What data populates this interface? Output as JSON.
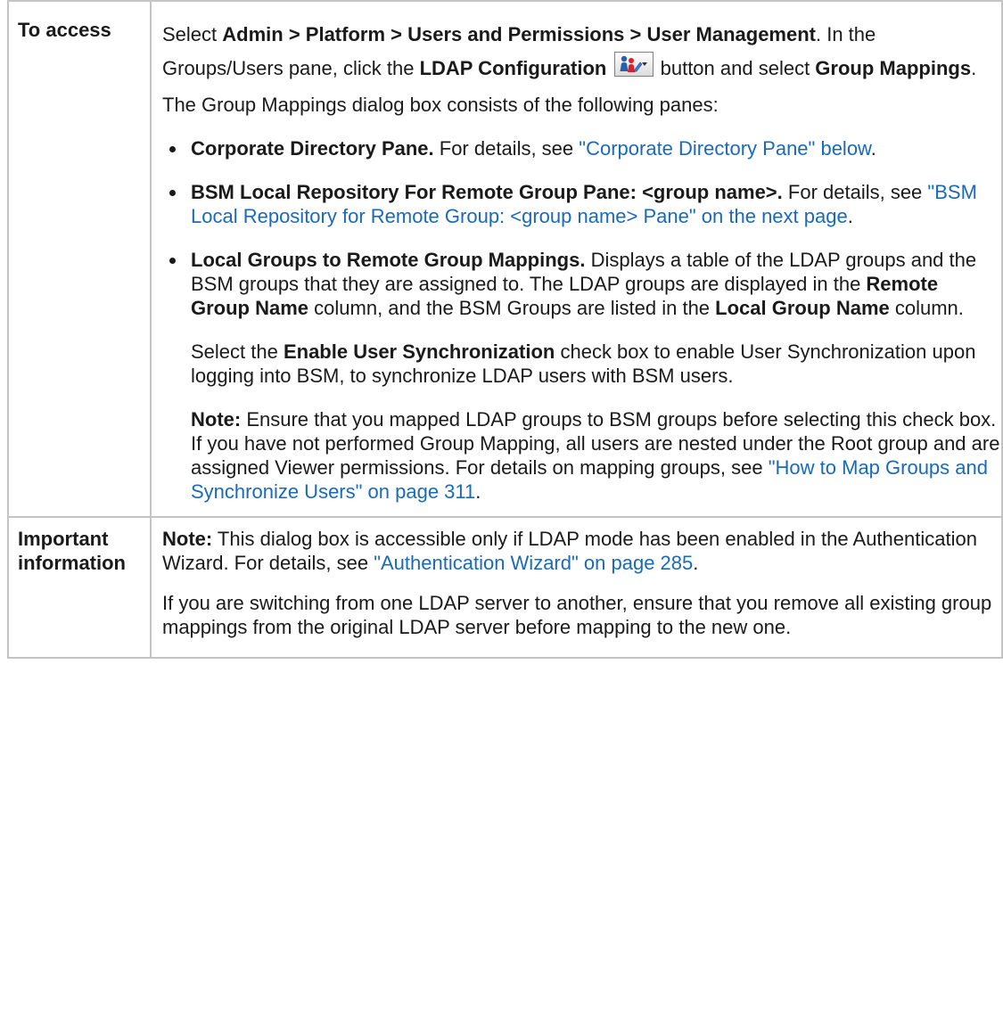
{
  "access": {
    "label": "To access",
    "intro": {
      "t1": "Select ",
      "path": "Admin > Platform > Users and Permissions > User Management",
      "t2": ". In the Groups/Users pane, click the ",
      "ldap_button": "LDAP Configuration",
      "t3": " button and select ",
      "group_mappings": "Group Mappings",
      "t4": "."
    },
    "consists": "The Group Mappings dialog box consists of the following panes:",
    "items": [
      {
        "title": "Corporate Directory Pane.",
        "text": " For details, see ",
        "link": "\"Corporate Directory Pane\" below",
        "end": "."
      },
      {
        "title": "BSM Local Repository For Remote Group Pane: <group name>.",
        "text": " For details, see ",
        "link": "\"BSM Local Repository for Remote Group: <group name> Pane\" on the next page",
        "end": "."
      },
      {
        "title": "Local Groups to Remote Group Mappings.",
        "text1": " Displays a table of the LDAP groups and the BSM groups that they are assigned to. The LDAP groups are displayed in the ",
        "remote_col": "Remote Group Name",
        "text2": " column, and the BSM Groups are listed in the ",
        "local_col": "Local Group Name",
        "text3": " column."
      }
    ],
    "sync": {
      "t1": "Select the ",
      "bold": "Enable User Synchronization",
      "t2": " check box to enable User Synchronization upon logging into BSM, to synchronize LDAP users with BSM users."
    },
    "note": {
      "label": "Note:",
      "text": " Ensure that you mapped LDAP groups to BSM groups before selecting this check box. If you have not performed Group Mapping, all users are nested under the Root group and are assigned Viewer permissions. For details on mapping groups, see ",
      "link": "\"How to Map Groups and Synchronize Users\" on page 311",
      "end": "."
    }
  },
  "important": {
    "label": "Important information",
    "note_label": "Note:",
    "note_text": " This dialog box is accessible only if LDAP mode has been enabled in the Authentication Wizard. For details, see ",
    "note_link": "\"Authentication Wizard\" on page 285",
    "note_end": ".",
    "switching": "If you are switching from one LDAP server to another, ensure that you remove all existing group mappings from the original LDAP server before mapping to the new one."
  },
  "icons": {
    "ldap_configuration": "ldap-configuration-icon"
  }
}
